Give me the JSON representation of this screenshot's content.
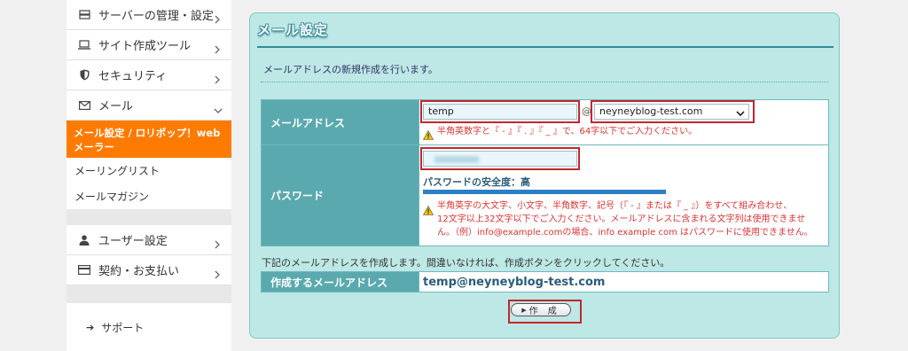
{
  "sidebar": {
    "items_top": [
      {
        "label": "サーバーの管理・設定",
        "icon": "server-icon"
      },
      {
        "label": "サイト作成ツール",
        "icon": "laptop-icon"
      },
      {
        "label": "セキュリティ",
        "icon": "shield-icon"
      },
      {
        "label": "メール",
        "icon": "mail-icon"
      }
    ],
    "active_item": "メール設定 / ロリポップ！webメーラー",
    "sub_items": [
      "メーリングリスト",
      "メールマガジン"
    ],
    "items_bottom": [
      {
        "label": "ユーザー設定",
        "icon": "user-icon"
      },
      {
        "label": "契約・お支払い",
        "icon": "card-icon"
      }
    ],
    "support": "サポート"
  },
  "panel": {
    "title": "メール設定",
    "intro": "メールアドレスの新規作成を行います。",
    "email": {
      "label": "メールアドレス",
      "value": "temp",
      "at": "@",
      "domain": "neyneyblog-test.com",
      "warning": "半角英数字と『 - 』『 . 』『 _ 』で、64字以下でご入力ください。"
    },
    "password": {
      "label": "パスワード",
      "strength": "パスワードの安全度：高",
      "warning_lines": [
        "半角英字の大文字、小文字、半角数字、記号（『 - 』または『 _ 』）をすべて組み合わせ、",
        "12文字以上32文字以下でご入力ください。メールアドレスに含まれる文字列は使用できませ",
        "ん。（例）info@example.comの場合、info example com はパスワードに使用できません。"
      ]
    },
    "confirm_text": "下記のメールアドレスを作成します。間違いなければ、作成ボタンをクリックしてください。",
    "result": {
      "label": "作成するメールアドレス",
      "value": "temp@neyneyblog-test.com"
    },
    "create_button": "作 成"
  },
  "colors": {
    "accent": "#ff7a00",
    "panel_bg": "#bde8e6",
    "header_cell": "#5aa9ae",
    "highlight": "#c0282c"
  }
}
